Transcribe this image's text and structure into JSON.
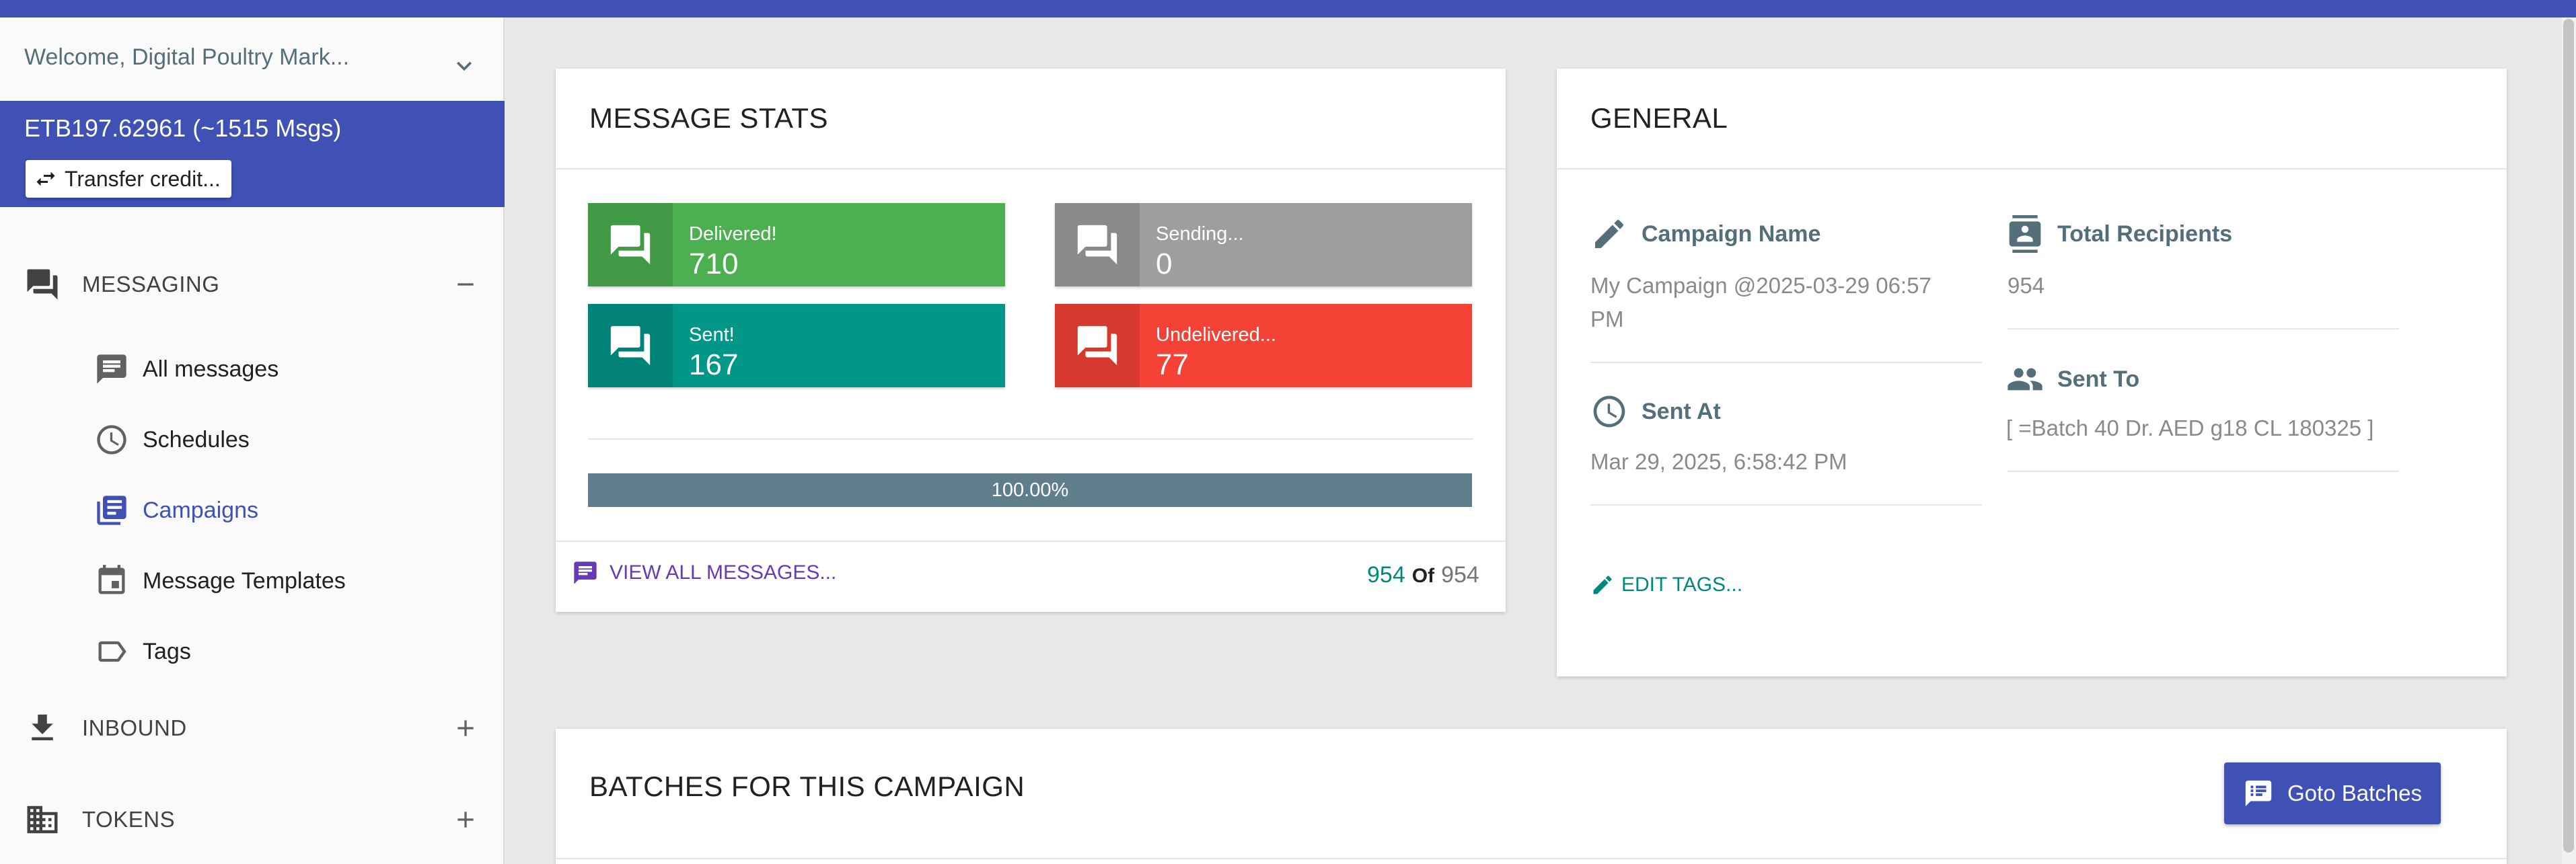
{
  "colors": {
    "primary": "#3f51b5",
    "delivered": "#4caf50",
    "sending": "#9e9e9e",
    "sent": "#009688",
    "undelivered": "#f44336",
    "progress": "#607d8b"
  },
  "sidebar": {
    "welcome": "Welcome, Digital Poultry Mark...",
    "credit": "ETB197.62961 (~1515 Msgs)",
    "transfer_label": "Transfer credit...",
    "sections": [
      {
        "label": "MESSAGING",
        "icon": "forum-icon",
        "toggle": "minus"
      },
      {
        "label": "INBOUND",
        "icon": "download-icon",
        "toggle": "plus"
      },
      {
        "label": "TOKENS",
        "icon": "building-icon",
        "toggle": "plus"
      }
    ],
    "items": [
      {
        "label": "All messages",
        "icon": "message-icon"
      },
      {
        "label": "Schedules",
        "icon": "clock-icon"
      },
      {
        "label": "Campaigns",
        "icon": "library-icon",
        "active": true
      },
      {
        "label": "Message Templates",
        "icon": "calendar-icon"
      },
      {
        "label": "Tags",
        "icon": "tag-icon"
      }
    ]
  },
  "stats": {
    "title": "MESSAGE STATS",
    "delivered": {
      "label": "Delivered!",
      "value": "710"
    },
    "sending": {
      "label": "Sending...",
      "value": "0"
    },
    "sent": {
      "label": "Sent!",
      "value": "167"
    },
    "undelivered": {
      "label": "Undelivered...",
      "value": "77"
    },
    "progress_text": "100.00%",
    "progress_fraction": 1.0,
    "view_all": "VIEW ALL MESSAGES...",
    "count_done": "954",
    "count_of": "Of",
    "count_total": "954"
  },
  "general": {
    "title": "GENERAL",
    "campaign_name_label": "Campaign Name",
    "campaign_name_value": "My Campaign @2025-03-29 06:57 PM",
    "total_recipients_label": "Total Recipients",
    "total_recipients_value": "954",
    "sent_at_label": "Sent At",
    "sent_at_value": "Mar 29, 2025, 6:58:42 PM",
    "sent_to_label": "Sent To",
    "sent_to_value": "[ =Batch 40 Dr. AED g18 CL 180325 ]",
    "edit_tags": "EDIT TAGS..."
  },
  "batches": {
    "title": "BATCHES FOR THIS CAMPAIGN",
    "goto_label": "Goto Batches"
  }
}
